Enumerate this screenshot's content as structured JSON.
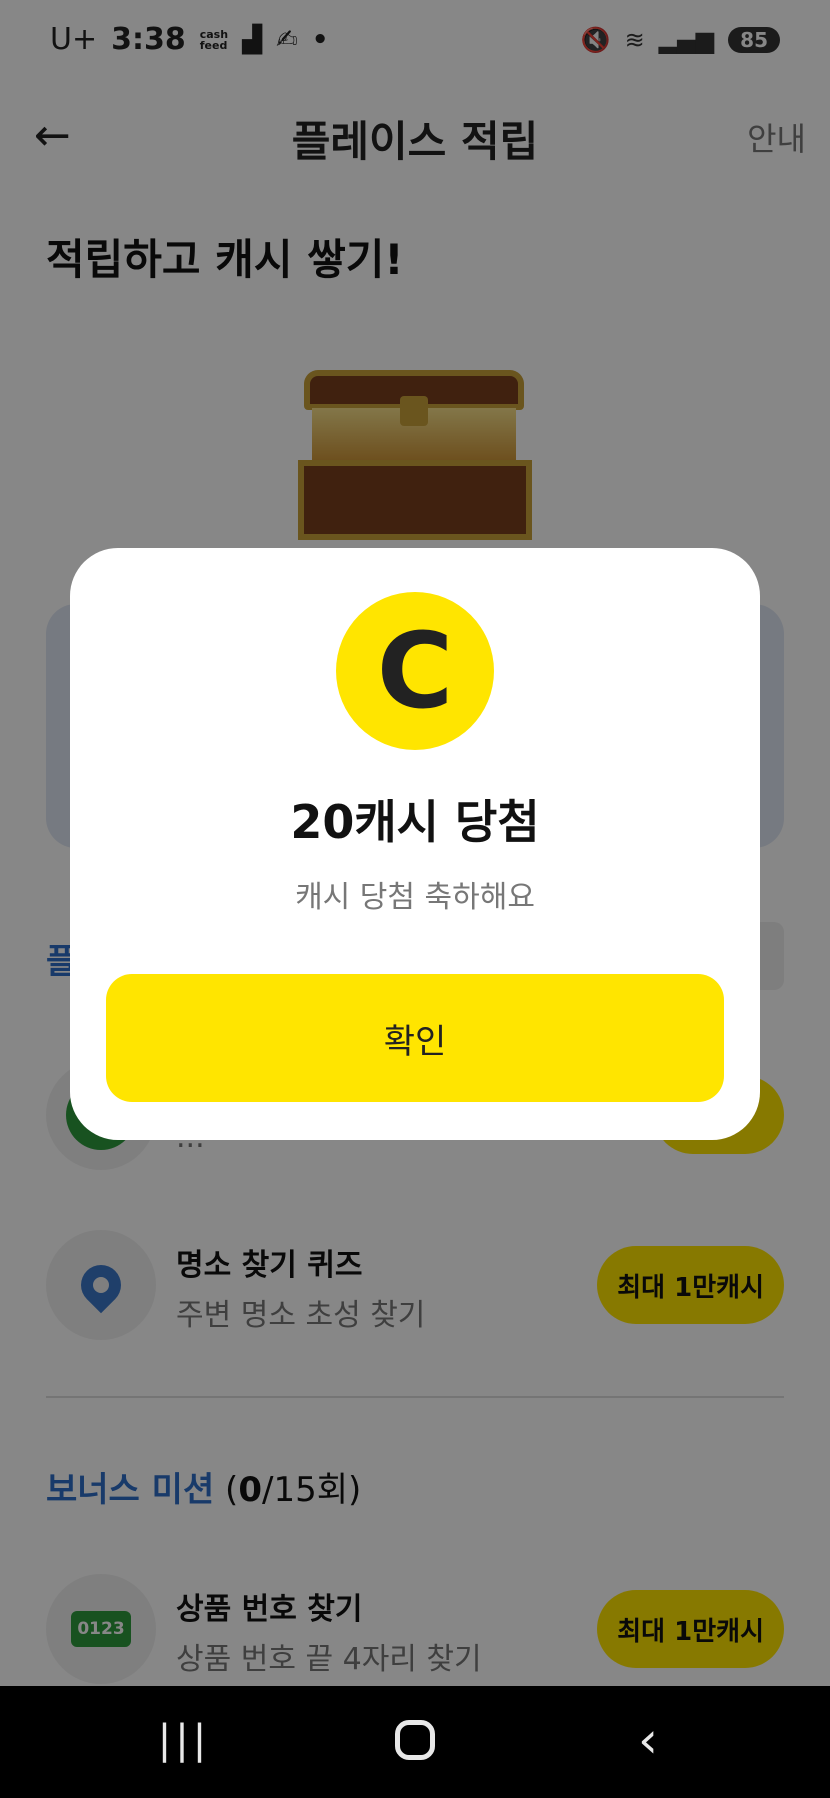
{
  "status_bar": {
    "carrier": "U+",
    "time": "3:38",
    "cash_mini": "cash\nfeed",
    "battery": "85",
    "icons": [
      "mute-icon",
      "wifi-icon",
      "signal-icon"
    ]
  },
  "header": {
    "back_icon": "arrow-left-icon",
    "title": "플레이스 적립",
    "info_link": "안내"
  },
  "page": {
    "heading": "적립하고 캐시 쌓기!",
    "section_label": "플",
    "missions": [
      {
        "title": "",
        "subtitle": "...",
        "reward": ""
      },
      {
        "title": "명소 찾기 퀴즈",
        "subtitle": "주변 명소 초성 찾기",
        "reward": "최대 1만캐시",
        "icon": "location-pin-icon"
      },
      {
        "title": "상품 번호 찾기",
        "subtitle": "상품 번호 끝 4자리 찾기",
        "reward": "최대 1만캐시",
        "icon_label": "0123"
      }
    ],
    "bonus": {
      "name": "보너스 미션",
      "open": " (",
      "count": "0",
      "total": "/15회)"
    }
  },
  "modal": {
    "coin_letter": "C",
    "title": "20캐시 당첨",
    "subtitle": "캐시 당첨 축하해요",
    "confirm_label": "확인"
  },
  "nav_bar": {
    "recent": "|||",
    "back": "‹"
  },
  "colors": {
    "accent_yellow": "#ffe500",
    "link_blue": "#2f6fc8",
    "green": "#2e9b3e"
  }
}
